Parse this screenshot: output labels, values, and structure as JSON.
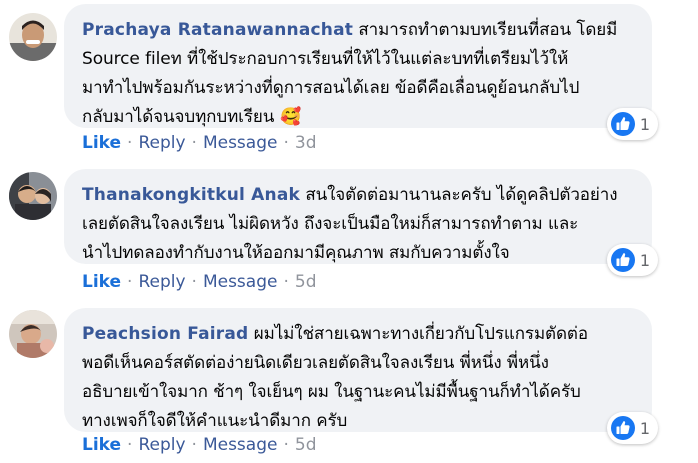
{
  "comments": [
    {
      "author": "Prachaya Ratanawannachat",
      "text": "สามารถทำตามบทเรียนที่สอน โดยมี\nSource fileท ที่ใช้ประกอบการเรียนที่ให้ไว้ในแต่ละบทที่เตรียมไว้ให้\nมาทำไปพร้อมกันระหว่างที่ดูการสอนได้เลย ข้อดีคือเลื่อนดูย้อนกลับไป\nกลับมาได้จนจบทุกบทเรียน",
      "emoji": "🥰",
      "reaction_count": "1",
      "like_label": "Like",
      "reply_label": "Reply",
      "message_label": "Message",
      "dot": "·",
      "time": "3d"
    },
    {
      "author": "Thanakongkitkul Anak",
      "text": "สนใจตัดต่อมานานละครับ ได้ดูคลิปตัวอย่าง\nเลยตัดสินใจลงเรียน ไม่ผิดหวัง ถึงจะเป็นมือใหม่ก็สามารถทำตาม และ\nนำไปทดลองทำกับงานให้ออกมามีคุณภาพ สมกับความตั้งใจ",
      "emoji": "",
      "reaction_count": "1",
      "like_label": "Like",
      "reply_label": "Reply",
      "message_label": "Message",
      "dot": "·",
      "time": "5d"
    },
    {
      "author": "Peachsion Fairad",
      "text": "ผมไม่ใช่สายเฉพาะทางเกี่ยวกับโปรแกรมตัดต่อ\nพอดีเห็นคอร์สตัดต่อง่ายนิดเดียวเลยตัดสินใจลงเรียน พี่หนึ่ง พี่หนึ่ง\nอธิบายเข้าใจมาก ช้าๆ ใจเย็นๆ ผม ในฐานะคนไม่มีพื้นฐานก็ทำได้ครับ\nทางเพจก็ใจดีให้คำแนะนำดีมาก ครับ",
      "emoji": "",
      "reaction_count": "1",
      "like_label": "Like",
      "reply_label": "Reply",
      "message_label": "Message",
      "dot": "·",
      "time": "5d"
    }
  ],
  "colors": {
    "author": "#385898",
    "like_action": "#1a6fd8",
    "bubble": "#f0f2f5",
    "like_icon": "#1877f2"
  },
  "icons": [
    "like-thumb-icon",
    "avatar"
  ]
}
